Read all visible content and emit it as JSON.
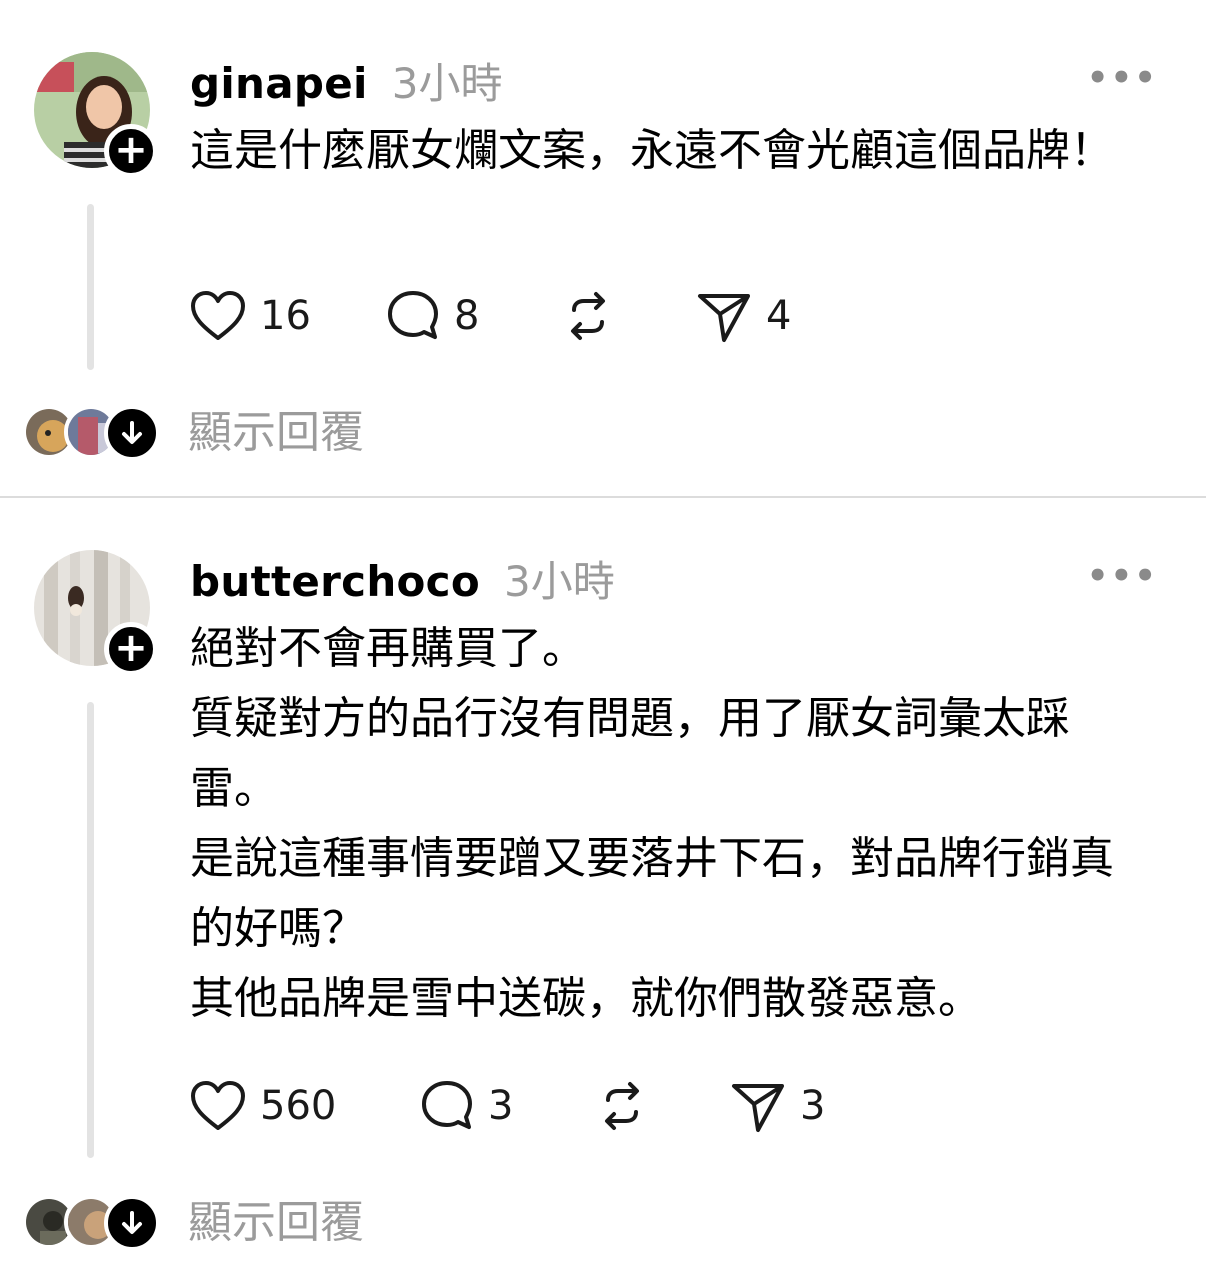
{
  "posts": [
    {
      "username": "ginapei",
      "time": "3小時",
      "more_label": "•••",
      "body_lines": [
        "這是什麼厭女爛文案，永遠不會光顧這個品牌！"
      ],
      "likes": "16",
      "comments": "8",
      "shares": "4",
      "show_replies": "顯示回覆",
      "follow_label": "+",
      "icons": [
        "heart-icon",
        "comment-icon",
        "repost-icon",
        "send-icon",
        "down-arrow-icon"
      ]
    },
    {
      "username": "butterchoco",
      "time": "3小時",
      "more_label": "•••",
      "body_lines": [
        "絕對不會再購買了。",
        "質疑對方的品行沒有問題，用了厭女詞彙太踩雷。",
        "是說這種事情要蹭又要落井下石，對品牌行銷真的好嗎？",
        "其他品牌是雪中送碳，就你們散發惡意。"
      ],
      "likes": "560",
      "comments": "3",
      "shares": "3",
      "show_replies": "顯示回覆",
      "follow_label": "+",
      "icons": [
        "heart-icon",
        "comment-icon",
        "repost-icon",
        "send-icon",
        "down-arrow-icon"
      ]
    }
  ],
  "colors": {
    "muted": "#9b9b9b",
    "divider": "#dcdcdc",
    "thread": "#e3e3e3"
  }
}
